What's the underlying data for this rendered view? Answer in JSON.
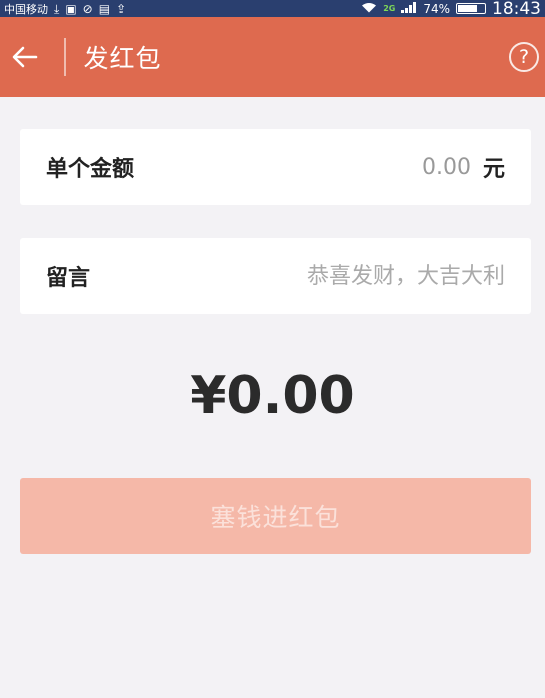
{
  "status_bar": {
    "carrier": "中国移动",
    "network": "2G",
    "battery": "74%",
    "battery_level": 0.74,
    "time": "18:43"
  },
  "header": {
    "title": "发红包",
    "help_symbol": "?"
  },
  "form": {
    "amount": {
      "label": "单个金额",
      "placeholder": "0.00",
      "unit": "元"
    },
    "message": {
      "label": "留言",
      "placeholder": "恭喜发财，大吉大利"
    }
  },
  "total": "¥0.00",
  "submit_label": "塞钱进红包",
  "colors": {
    "header_bg": "#de6a4f",
    "button_disabled_bg": "#f5b8a8",
    "page_bg": "#f3f2f5"
  },
  "icons": {
    "back": "arrow-left-icon",
    "help": "help-circle-icon"
  }
}
